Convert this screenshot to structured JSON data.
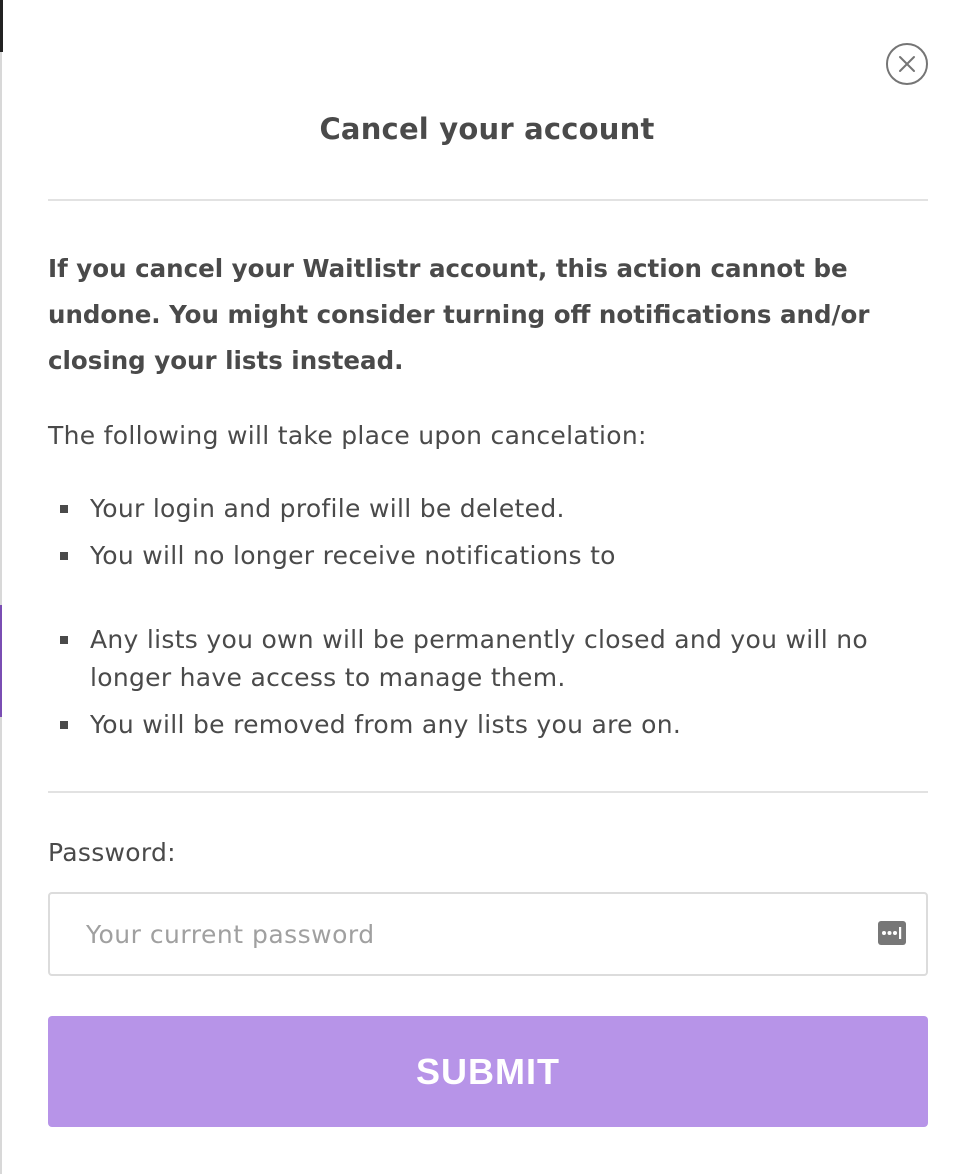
{
  "modal": {
    "title": "Cancel your account",
    "warning": "If you cancel your Waitlistr account, this action cannot be undone. You might consider turning off notifications and/or closing your lists instead.",
    "intro": "The following will take place upon cancelation:",
    "consequences": [
      "Your login and profile will be deleted.",
      "You will no longer receive notifications to",
      "Any lists you own will be permanently closed and you will no longer have access to manage them.",
      "You will be removed from any lists you are on."
    ],
    "password_label": "Password:",
    "password_placeholder": "Your current password",
    "password_value": "",
    "submit_label": "SUBMIT"
  },
  "icons": {
    "close": "close-icon",
    "password_manager": "password-manager-icon"
  },
  "colors": {
    "submit_bg": "#b794e8",
    "text": "#4a4a4a",
    "divider": "#e2e2e2",
    "accent": "#7a4db3"
  }
}
